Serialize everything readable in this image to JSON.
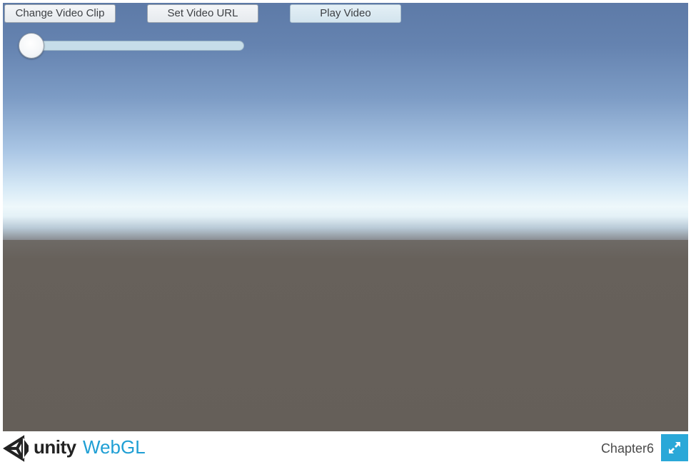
{
  "game": {
    "buttons": {
      "change_clip": "Change Video Clip",
      "set_url": "Set Video URL",
      "play": "Play Video"
    },
    "slider": {
      "value": 0.0
    },
    "scene": {
      "sky_color": "#7d9cc5",
      "horizon_color": "#eef8fb",
      "ground_color": "#655f59"
    }
  },
  "footer": {
    "logo_icon": "unity-logo-icon",
    "brand": "unity",
    "platform": "WebGL",
    "build_title": "Chapter6",
    "fullscreen_icon": "fullscreen-icon",
    "accent_color": "#2aa8d8"
  }
}
